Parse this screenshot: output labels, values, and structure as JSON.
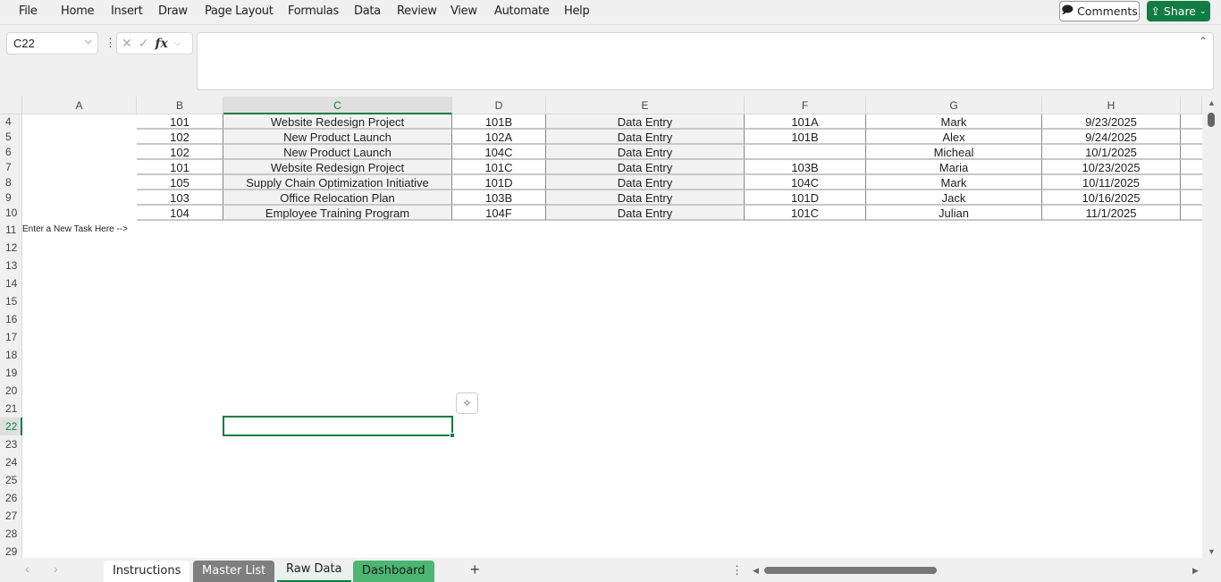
{
  "menu": [
    "File",
    "Home",
    "Insert",
    "Draw",
    "Page Layout",
    "Formulas",
    "Data",
    "Review",
    "View",
    "Automate",
    "Help"
  ],
  "actions": {
    "comments": "Comments",
    "share": "Share"
  },
  "name_box": "C22",
  "formula_bar": {
    "fx": "fx",
    "value": ""
  },
  "columns": [
    "A",
    "B",
    "C",
    "D",
    "E",
    "F",
    "G",
    "H"
  ],
  "selected_column": "C",
  "rows": [
    {
      "n": "4",
      "b": "101",
      "c": "Website Redesign Project",
      "d": "101B",
      "e": "Data Entry",
      "f": "101A",
      "g": "Mark",
      "h": "9/23/2025"
    },
    {
      "n": "5",
      "b": "102",
      "c": "New Product Launch",
      "d": "102A",
      "e": "Data Entry",
      "f": "101B",
      "g": "Alex",
      "h": "9/24/2025"
    },
    {
      "n": "6",
      "b": "102",
      "c": "New Product Launch",
      "d": "104C",
      "e": "Data Entry",
      "f": "",
      "g": "Micheal",
      "h": "10/1/2025"
    },
    {
      "n": "7",
      "b": "101",
      "c": "Website Redesign Project",
      "d": "101C",
      "e": "Data Entry",
      "f": "103B",
      "g": "Maria",
      "h": "10/23/2025"
    },
    {
      "n": "8",
      "b": "105",
      "c": "Supply Chain Optimization Initiative",
      "d": "101D",
      "e": "Data Entry",
      "f": "104C",
      "g": "Mark",
      "h": "10/11/2025"
    },
    {
      "n": "9",
      "b": "103",
      "c": "Office Relocation Plan",
      "d": "103B",
      "e": "Data Entry",
      "f": "101D",
      "g": "Jack",
      "h": "10/16/2025"
    },
    {
      "n": "10",
      "b": "104",
      "c": "Employee Training Program",
      "d": "104F",
      "e": "Data Entry",
      "f": "101C",
      "g": "Julian",
      "h": "11/1/2025"
    }
  ],
  "note_row": {
    "n": "11",
    "text": "Enter a New Task Here -->"
  },
  "empty_rows": [
    "12",
    "13",
    "14",
    "15",
    "16",
    "17",
    "18",
    "19",
    "20",
    "21",
    "22",
    "23",
    "24",
    "25",
    "26",
    "27",
    "28",
    "29"
  ],
  "selected_row": "22",
  "sheets": [
    {
      "name": "Instructions",
      "bg": "#ffffff",
      "fg": "#222222"
    },
    {
      "name": "Master List",
      "bg": "#7f7f7f",
      "fg": "#ffffff"
    },
    {
      "name": "Raw Data",
      "bg": "#f0f0f0",
      "fg": "#222222",
      "active": true
    },
    {
      "name": "Dashboard",
      "bg": "#4cb573",
      "fg": "#1a1a1a"
    }
  ],
  "add_sheet": "+"
}
